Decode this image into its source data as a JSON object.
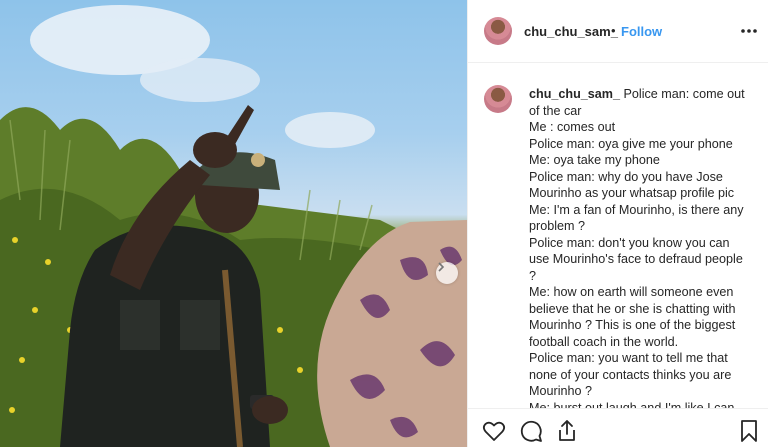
{
  "post": {
    "username": "chu_chu_sam_",
    "separator": "•",
    "follow_label": "Follow"
  },
  "caption": {
    "author": "chu_chu_sam_",
    "first_line": "Police man: come out of the car",
    "lines": [
      "Me : comes out",
      "Police man: oya give me your phone",
      "Me: oya take my phone",
      "Police man: why do you have Jose Mourinho as your whatsap profile pic",
      "Me: I'm a fan of Mourinho, is there any problem ?",
      "Police man: don't you know you can use Mourinho's face to defraud people ?",
      "Me: how on earth will someone even believe that he or she is chatting with Mourinho ? This is one of the biggest football coach in the world.",
      "Police man: you want to tell me that none of your contacts thinks you are Mourinho ?",
      "Me: burst out laugh and I'm like I can"
    ]
  },
  "icons": {
    "more": "more-options-icon",
    "like": "heart-icon",
    "comment": "comment-icon",
    "share": "share-icon",
    "save": "bookmark-icon",
    "carousel": "chevron-right-icon"
  },
  "colors": {
    "link": "#3897f0",
    "text": "#262626",
    "border": "#efefef"
  }
}
